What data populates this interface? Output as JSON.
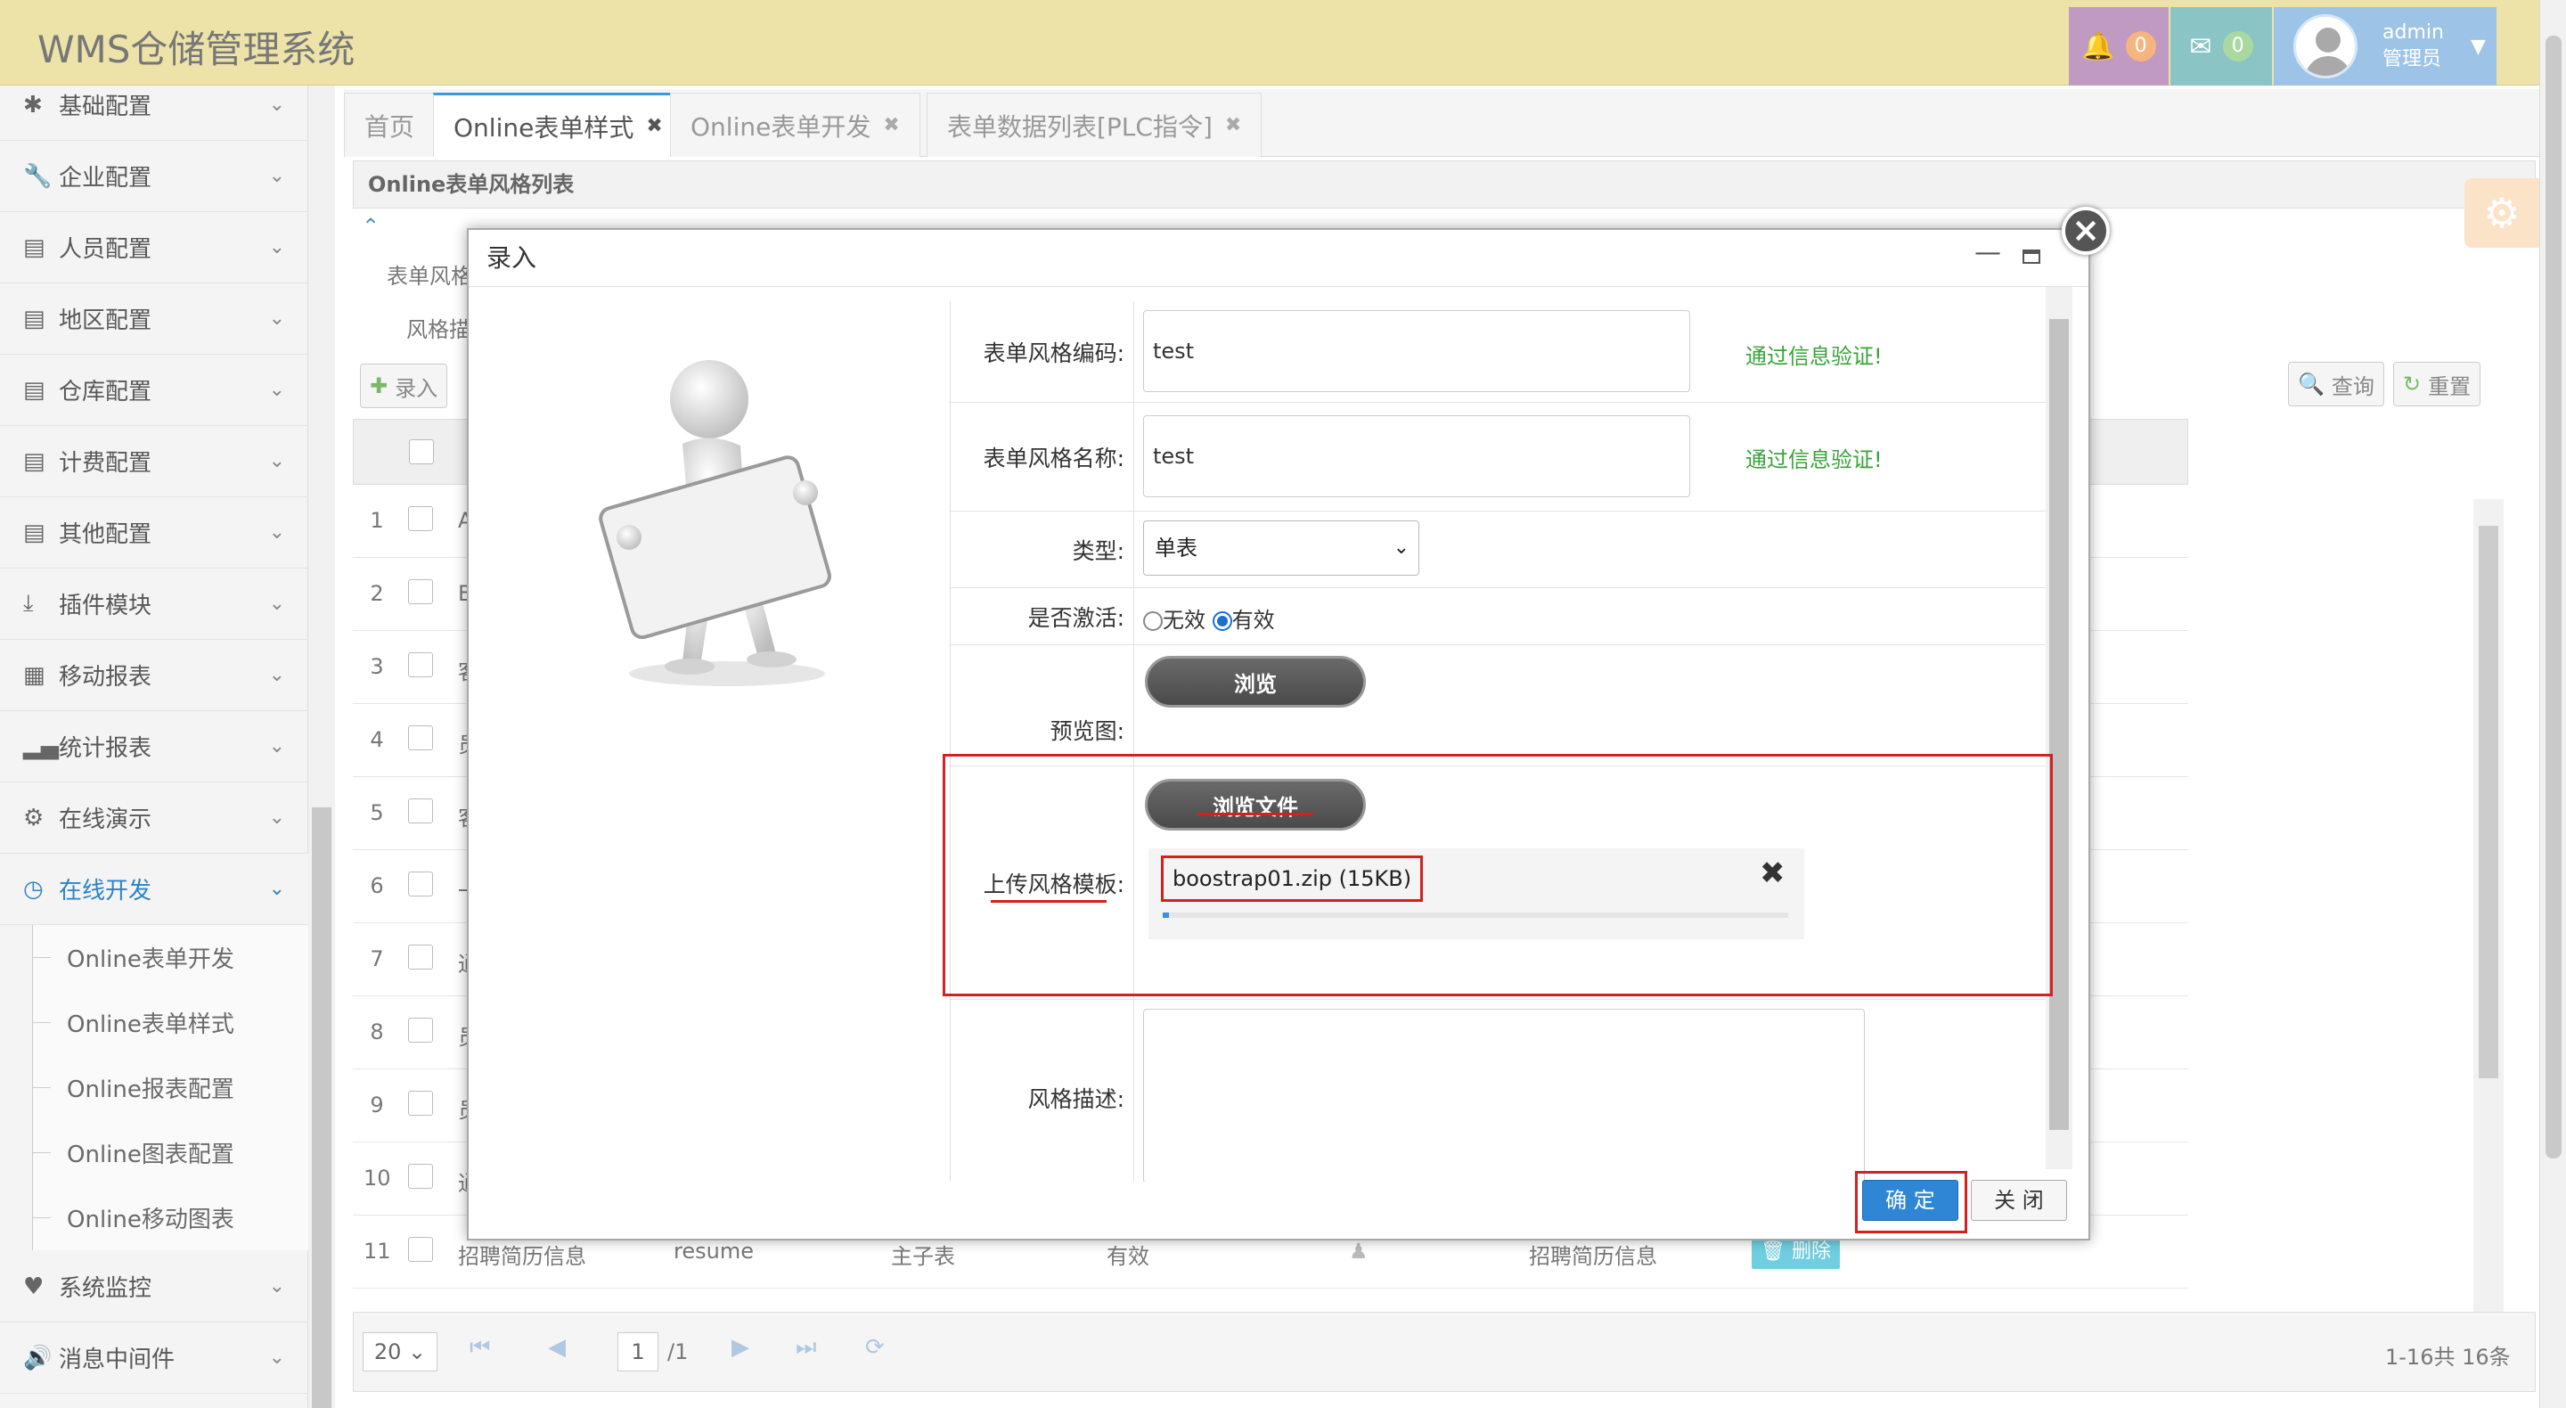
{
  "app": {
    "title": "WMS仓储管理系统"
  },
  "header": {
    "notifications_count": "0",
    "messages_count": "0",
    "user_name": "admin",
    "user_role": "管理员"
  },
  "sidebar": {
    "items": [
      {
        "label": "基础配置",
        "icon": "asterisk-icon"
      },
      {
        "label": "企业配置",
        "icon": "wrench-icon"
      },
      {
        "label": "人员配置",
        "icon": "list-icon"
      },
      {
        "label": "地区配置",
        "icon": "list-icon"
      },
      {
        "label": "仓库配置",
        "icon": "list-icon"
      },
      {
        "label": "计费配置",
        "icon": "list-icon"
      },
      {
        "label": "其他配置",
        "icon": "list-icon"
      },
      {
        "label": "插件模块",
        "icon": "download-icon"
      },
      {
        "label": "移动报表",
        "icon": "grid-icon"
      },
      {
        "label": "统计报表",
        "icon": "signal-icon"
      },
      {
        "label": "在线演示",
        "icon": "gear-icon"
      },
      {
        "label": "在线开发",
        "icon": "clock-icon"
      },
      {
        "label": "系统监控",
        "icon": "heart-icon"
      },
      {
        "label": "消息中间件",
        "icon": "volume-icon"
      }
    ],
    "subitems": [
      "Online表单开发",
      "Online表单样式",
      "Online报表配置",
      "Online图表配置",
      "Online移动图表"
    ]
  },
  "tabs": [
    {
      "label": "首页"
    },
    {
      "label": "Online表单样式"
    },
    {
      "label": "Online表单开发"
    },
    {
      "label": "表单数据列表[PLC指令]"
    }
  ],
  "panel": {
    "title": "Online表单风格列表",
    "filter_label_1": "表单风格",
    "filter_label_2": "风格描",
    "add_button": "录入",
    "query_button": "查询",
    "reset_button": "重置"
  },
  "grid": {
    "row_numbers": [
      "1",
      "2",
      "3",
      "4",
      "5",
      "6",
      "7",
      "8",
      "9",
      "10",
      "11"
    ],
    "row_first_chars": [
      "A",
      "E",
      "客",
      "员",
      "客",
      "一",
      "通",
      "员",
      "员",
      "通",
      ""
    ],
    "row11": {
      "name": "招聘简历信息",
      "code": "resume",
      "type": "主子表",
      "status": "有效",
      "desc": "招聘简历信息",
      "delete": "删除"
    }
  },
  "pager": {
    "page_size": "20",
    "page": "1",
    "total_pages": "/1",
    "summary": "1-16共 16条"
  },
  "modal": {
    "title": "录入",
    "code_label": "表单风格编码:",
    "code_value": "test",
    "code_valid": "通过信息验证!",
    "name_label": "表单风格名称:",
    "name_value": "test",
    "name_valid": "通过信息验证!",
    "type_label": "类型:",
    "type_value": "单表",
    "active_label": "是否激活:",
    "active_opt_off": "无效",
    "active_opt_on": "有效",
    "preview_label": "预览图:",
    "browse_button": "浏览",
    "upload_label": "上传风格模板:",
    "browse_file_button": "浏览文件",
    "file_name": "boostrap01.zip (15KB)",
    "desc_label": "风格描述:",
    "ok_button": "确 定",
    "close_button": "关 闭"
  },
  "colors": {
    "topbar": "#ede3a8",
    "accent": "#2c82c9",
    "valid": "#3aa23a",
    "highlight": "#d42020"
  }
}
